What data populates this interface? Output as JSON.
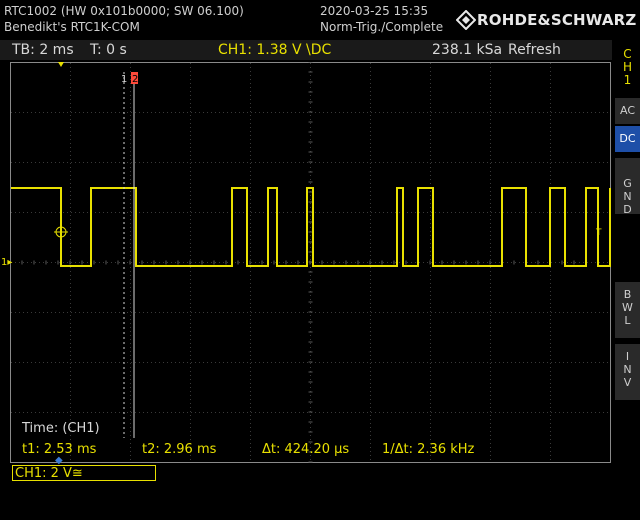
{
  "header": {
    "device": "RTC1002 (HW 0x101b0000; SW 06.100)",
    "owner": "Benedikt's RTC1K-COM",
    "datetime": "2020-03-25 15:35",
    "trigger_state": "Norm-Trig./Complete",
    "brand": "ROHDE&SCHWARZ",
    "brand_icon": "rs-diamond-logo"
  },
  "status": {
    "timebase": "TB: 2 ms",
    "time_offset": "T: 0 s",
    "ch1_setting": "CH1: 1.38 V \\DC",
    "sample_rate": "238.1 kSa",
    "mode": "Refresh"
  },
  "side_menu": {
    "title": [
      "C",
      "H",
      "1"
    ],
    "items": [
      {
        "label": "AC",
        "active": false
      },
      {
        "label": "DC",
        "active": true
      },
      {
        "label": "G N D",
        "active": false
      },
      {
        "label": "B W L",
        "active": false
      },
      {
        "label": "I N V",
        "active": false
      }
    ]
  },
  "cursors": {
    "c1_label": "1",
    "c2_label": "2",
    "trigger_marker": "T",
    "ch_marker": "1"
  },
  "measurement": {
    "title": "Time: (CH1)",
    "t1": "t1: 2.53 ms",
    "t2": "t2: 2.96 ms",
    "delta": "Δt: 424.20 µs",
    "inv_delta": "1/Δt: 2.36 kHz"
  },
  "channel_box": {
    "label": "CH1: 2 V≅"
  },
  "colors": {
    "trace": "#e8e000",
    "grid": "#3a3a3a",
    "accent_active": "#1e4fa8",
    "cursor2": "#ff4a3a"
  },
  "trace": {
    "high_div": 1.0,
    "low_div": 0.0,
    "transitions_div": [
      0.85,
      1.35,
      2.1,
      3.7,
      3.95,
      4.3,
      4.45,
      4.95,
      5.05,
      6.45,
      6.55,
      6.8,
      7.05,
      8.2,
      8.6,
      9.0,
      9.25,
      9.6,
      9.8,
      10.0
    ]
  }
}
